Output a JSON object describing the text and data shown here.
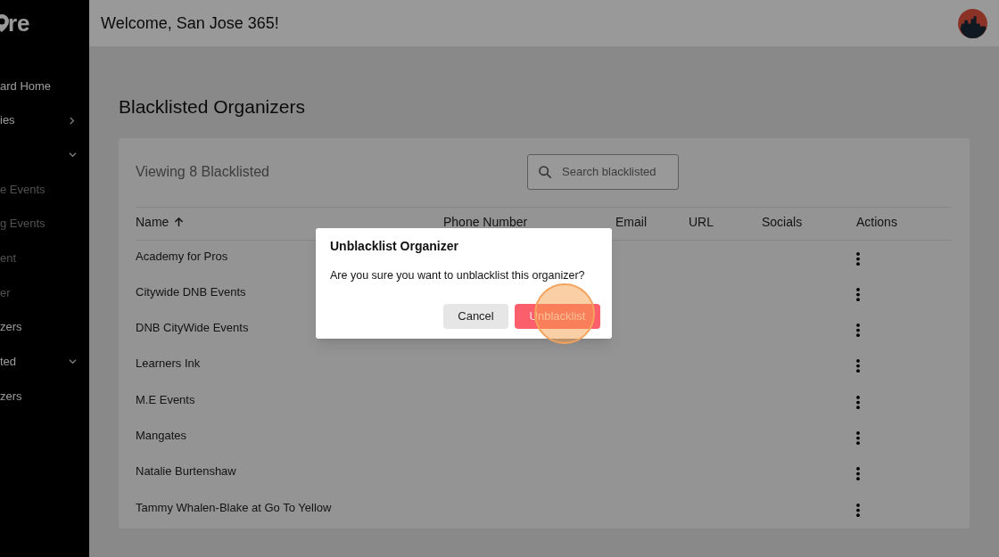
{
  "sidebar": {
    "logo": "re",
    "items": [
      {
        "label": "ard Home",
        "kind": "link"
      },
      {
        "label": "ies",
        "kind": "group",
        "expanded": false
      },
      {
        "kind": "group",
        "expanded": true
      },
      {
        "label": "e Events",
        "kind": "sub"
      },
      {
        "label": "g Events",
        "kind": "sub"
      },
      {
        "label": "ent",
        "kind": "sub"
      },
      {
        "label": "er",
        "kind": "sub"
      },
      {
        "label": "zers",
        "kind": "link"
      },
      {
        "label": "ted",
        "kind": "group",
        "expanded": true
      },
      {
        "label": "zers",
        "kind": "link"
      }
    ]
  },
  "header": {
    "welcome": "Welcome, San Jose 365!"
  },
  "page_title": "Blacklisted Organizers",
  "summary": "Viewing 8 Blacklisted",
  "search": {
    "placeholder": "Search blacklisted"
  },
  "table": {
    "columns": [
      "Name",
      "Phone Number",
      "Email",
      "URL",
      "Socials",
      "Actions"
    ],
    "rows": [
      {
        "name": "Academy for Pros"
      },
      {
        "name": "Citywide DNB Events"
      },
      {
        "name": "DNB CityWide Events"
      },
      {
        "name": "Learners Ink"
      },
      {
        "name": "M.E Events"
      },
      {
        "name": "Mangates"
      },
      {
        "name": "Natalie Burtenshaw"
      },
      {
        "name": "Tammy Whalen-Blake at Go To Yellow"
      }
    ]
  },
  "dialog": {
    "title": "Unblacklist Organizer",
    "message": "Are you sure you want to unblacklist this organizer?",
    "buttons": [
      {
        "label": "Cancel",
        "kind": "secondary"
      },
      {
        "label": "Unblacklist",
        "kind": "danger"
      }
    ]
  }
}
